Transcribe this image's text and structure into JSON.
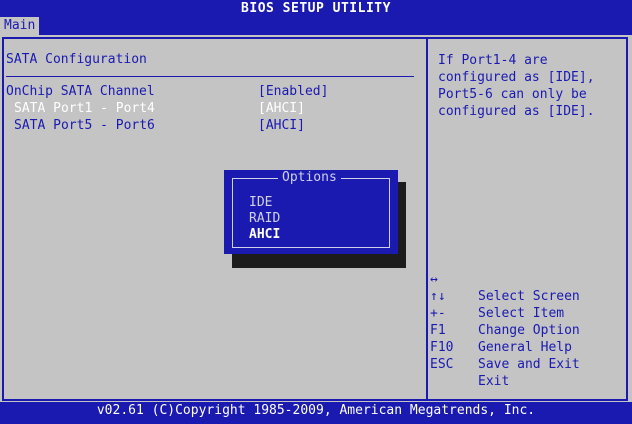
{
  "title": "BIOS SETUP UTILITY",
  "menu": {
    "active_tab": "Main"
  },
  "section": {
    "title": "SATA Configuration"
  },
  "settings": [
    {
      "label": "OnChip SATA Channel",
      "value": "[Enabled]"
    },
    {
      "label": "SATA Port1 - Port4",
      "value": "[AHCI]"
    },
    {
      "label": "SATA Port5 - Port6",
      "value": "[AHCI]"
    }
  ],
  "help": {
    "text": "If Port1-4 are\nconfigured as [IDE],\nPort5-6 can only be\nconfigured as [IDE]."
  },
  "keys": [
    {
      "key": "↔",
      "desc": "Select Screen"
    },
    {
      "key": "↑↓",
      "desc": "Select Item"
    },
    {
      "key": "+-",
      "desc": "Change Option"
    },
    {
      "key": "F1",
      "desc": "General Help"
    },
    {
      "key": "F10",
      "desc": "Save and Exit"
    },
    {
      "key": "ESC",
      "desc": "Exit"
    }
  ],
  "options_popup": {
    "title": "Options",
    "items": [
      "IDE",
      "RAID",
      "AHCI"
    ],
    "selected": "AHCI"
  },
  "footer": {
    "text": "v02.61 (C)Copyright 1985-2009, American Megatrends, Inc."
  },
  "colors": {
    "bios_blue": "#1a1ab0",
    "bios_gray": "#c4c4c4",
    "highlight": "#ffffff"
  }
}
